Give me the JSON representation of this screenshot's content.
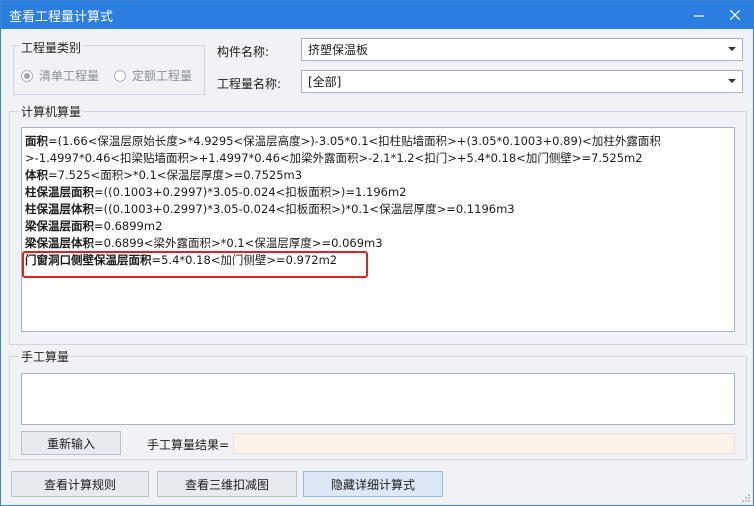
{
  "window": {
    "title": "查看工程量计算式",
    "minimize_label": "–",
    "close_label": "✕"
  },
  "category": {
    "legend": "工程量类别",
    "options": [
      {
        "label": "清单工程量",
        "selected": true
      },
      {
        "label": "定额工程量",
        "selected": false
      }
    ]
  },
  "component": {
    "label": "构件名称:",
    "value": "挤塑保温板"
  },
  "quantity": {
    "label": "工程量名称:",
    "value": "[全部]"
  },
  "computer_calc": {
    "legend": "计算机算量",
    "lines": [
      {
        "name": "面积",
        "expr": "=(1.66<保温层原始长度>*4.9295<保温层高度>)-3.05*0.1<扣柱贴墙面积>+(3.05*0.1003+0.89)<加柱外露面积>-1.4997*0.46<扣梁贴墙面积>+1.4997*0.46<加梁外露面积>-2.1*1.2<扣门>+5.4*0.18<加门侧壁>=7.525m2"
      },
      {
        "name": "体积",
        "expr": "=7.525<面积>*0.1<保温层厚度>=0.7525m3"
      },
      {
        "name": "柱保温层面积",
        "expr": "=((0.1003+0.2997)*3.05-0.024<扣板面积>)=1.196m2"
      },
      {
        "name": "柱保温层体积",
        "expr": "=((0.1003+0.2997)*3.05-0.024<扣板面积>)*0.1<保温层厚度>=0.1196m3"
      },
      {
        "name": "梁保温层面积",
        "expr": "=0.6899m2"
      },
      {
        "name": "梁保温层体积",
        "expr": "=0.6899<梁外露面积>*0.1<保温层厚度>=0.069m3"
      },
      {
        "name": "门窗洞口侧壁保温层面积",
        "expr": "=5.4*0.18<加门侧壁>=0.972m2"
      }
    ]
  },
  "manual": {
    "legend": "手工算量",
    "input_value": "",
    "reinput_label": "重新输入",
    "result_label": "手工算量结果=",
    "result_value": ""
  },
  "footer": {
    "rules_label": "查看计算规则",
    "view3d_label": "查看三维扣减图",
    "hide_label": "隐藏详细计算式"
  },
  "colors": {
    "titlebar": "#2a7ee0",
    "highlight": "#e22020"
  }
}
